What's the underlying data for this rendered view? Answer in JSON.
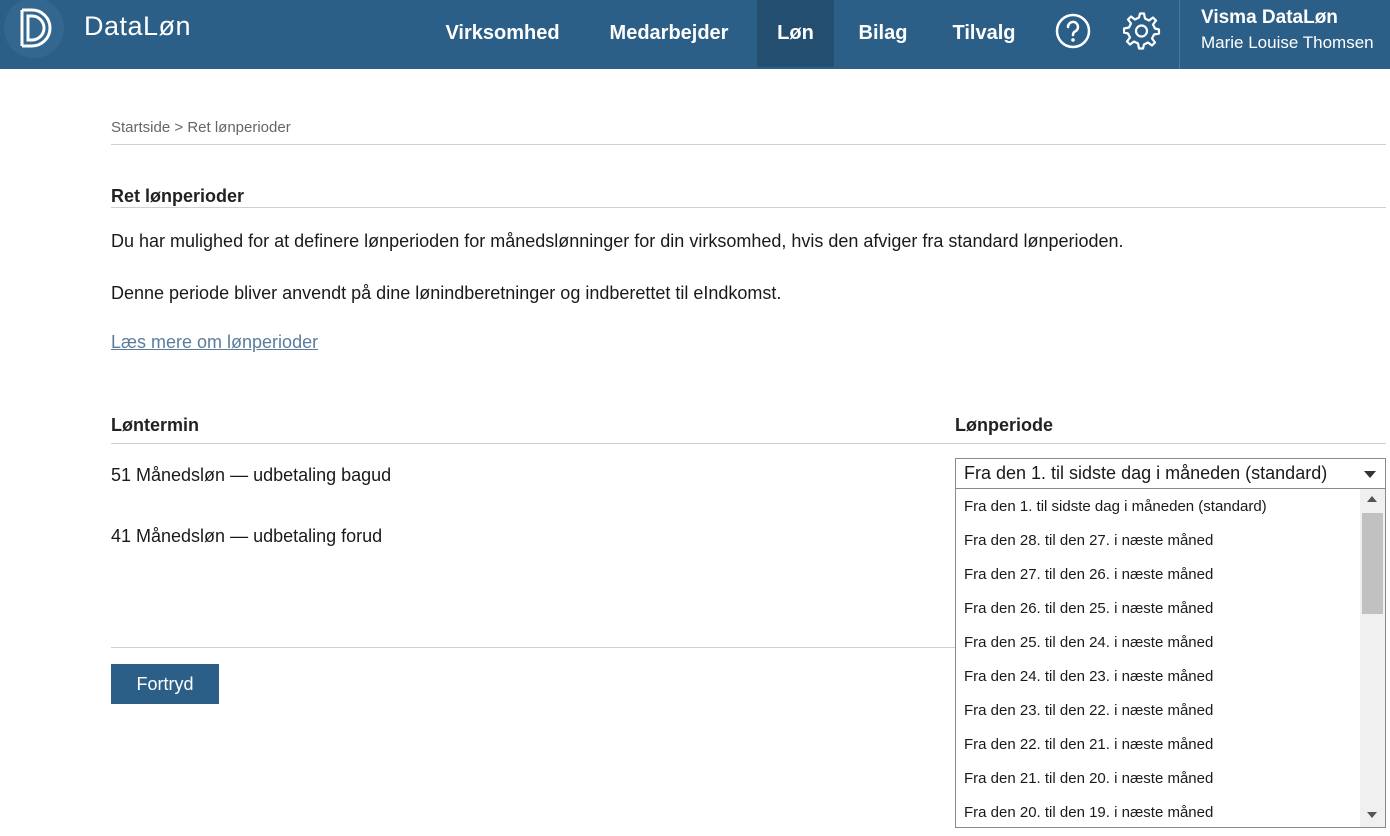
{
  "header": {
    "brand": "DataLøn",
    "nav": [
      {
        "label": "Virksomhed",
        "active": false
      },
      {
        "label": "Medarbejder",
        "active": false
      },
      {
        "label": "Løn",
        "active": true
      },
      {
        "label": "Bilag",
        "active": false
      },
      {
        "label": "Tilvalg",
        "active": false
      }
    ],
    "help_icon": "help-circle-icon",
    "settings_icon": "gear-icon",
    "user": {
      "org": "Visma DataLøn",
      "name": "Marie Louise Thomsen"
    }
  },
  "breadcrumb": {
    "home": "Startside",
    "separator": ">",
    "current": "Ret lønperioder"
  },
  "section": {
    "title": "Ret lønperioder",
    "paragraph1": "Du har mulighed for at definere lønperioden for månedslønninger for din virksomhed, hvis den afviger fra standard lønperioden.",
    "paragraph2": "Denne periode bliver anvendt på dine lønindberetninger og indberettet til eIndkomst.",
    "link": "Læs mere om lønperioder"
  },
  "table": {
    "col_termin": "Løntermin",
    "col_periode": "Lønperiode",
    "rows": [
      {
        "termin": "51 Månedsløn — udbetaling bagud"
      },
      {
        "termin": "41 Månedsløn — udbetaling forud"
      }
    ]
  },
  "select": {
    "value": "Fra den 1. til sidste dag i måneden (standard)",
    "options": [
      "Fra den 1. til sidste dag i måneden (standard)",
      "Fra den 28. til den 27. i næste måned",
      "Fra den 27. til den 26. i næste måned",
      "Fra den 26. til den 25. i næste måned",
      "Fra den 25. til den 24. i næste måned",
      "Fra den 24. til den 23. i næste måned",
      "Fra den 23. til den 22. i næste måned",
      "Fra den 22. til den 21. i næste måned",
      "Fra den 21. til den 20. i næste måned",
      "Fra den 20. til den 19. i næste måned"
    ]
  },
  "buttons": {
    "cancel": "Fortryd"
  },
  "colors": {
    "header": "#2c5f87",
    "nav_active": "#244e70",
    "link": "#5b7d9c",
    "button": "#2c5f87"
  }
}
